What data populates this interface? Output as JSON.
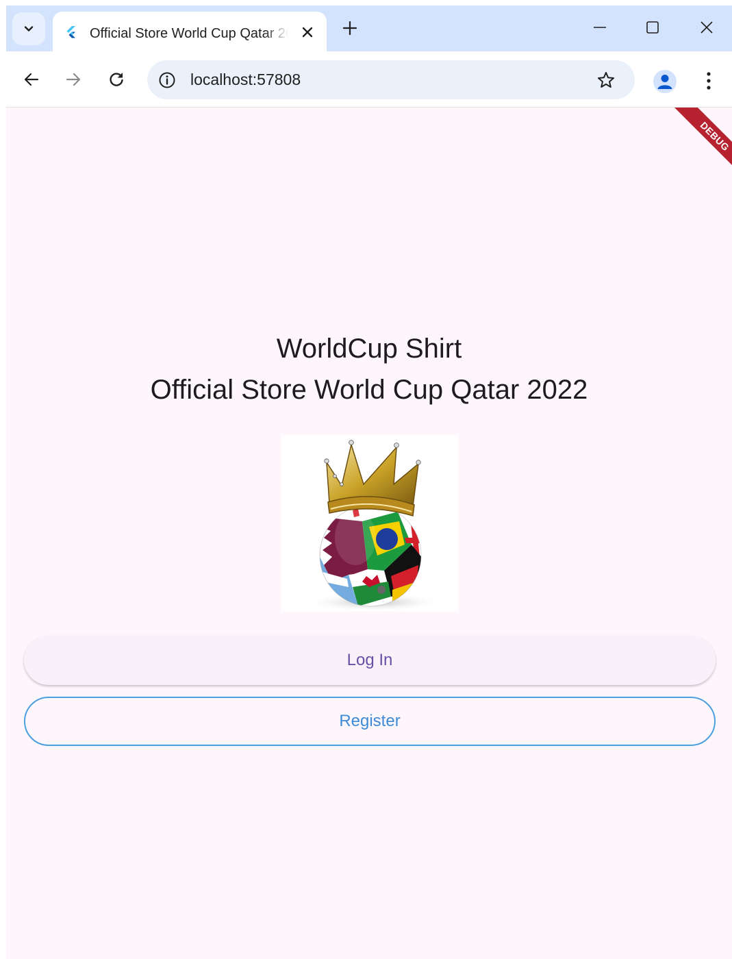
{
  "browser": {
    "tab_title": "Official Store World Cup Qatar 2022",
    "url": "localhost:57808"
  },
  "app": {
    "debug_label": "DEBUG",
    "title_line1": "WorldCup Shirt",
    "title_line2": "Official Store World Cup Qatar 2022",
    "login_label": "Log In",
    "register_label": "Register"
  },
  "colors": {
    "tabstrip": "#d3e3fd",
    "page_background": "#fdf7fd",
    "login_text": "#6750a4",
    "register_accent": "#4b9fde",
    "debug_banner": "#b6222f"
  },
  "icons": [
    "tab-search-icon",
    "flutter-logo-icon",
    "close-icon",
    "plus-icon",
    "minimize-icon",
    "maximize-icon",
    "window-close-icon",
    "back-arrow-icon",
    "forward-arrow-icon",
    "reload-icon",
    "info-icon",
    "star-icon",
    "profile-icon",
    "more-vert-icon"
  ]
}
